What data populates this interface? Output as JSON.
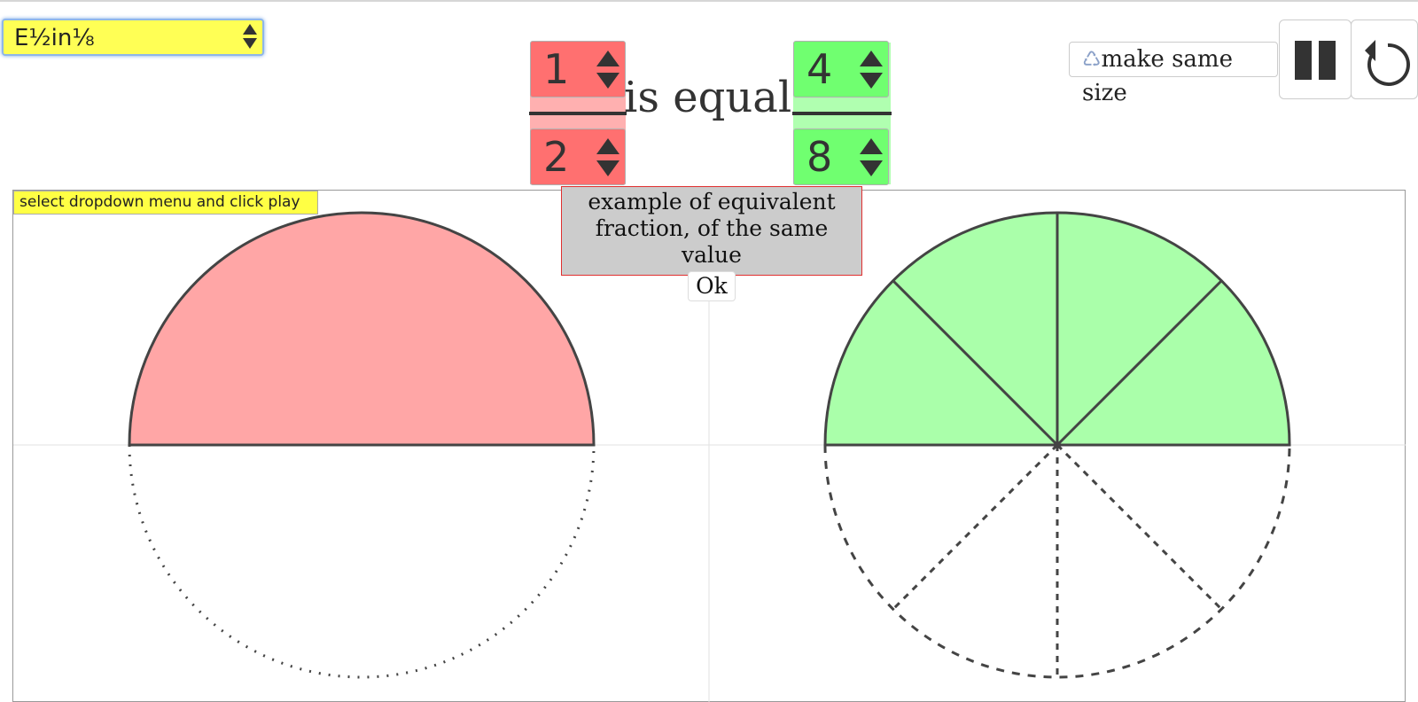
{
  "dropdown": {
    "selected": "E½in⅛"
  },
  "fraction_left": {
    "numerator": "1",
    "denominator": "2",
    "color": "#ff7070"
  },
  "equality_text": "is equal",
  "fraction_right": {
    "numerator": "4",
    "denominator": "8",
    "color": "#70ff70"
  },
  "toolbar": {
    "make_same_size_label": "make same size",
    "make_same_size_icon": "recycle-icon",
    "pause_icon": "pause-icon",
    "reset_icon": "reset-icon"
  },
  "hint": "select dropdown menu and click play",
  "dialog": {
    "line1": "example of equivalent",
    "line2": "fraction, of the same value",
    "ok_label": "Ok"
  },
  "colors": {
    "left_fill": "#ffa6a6",
    "right_fill": "#aaffaa",
    "hint_bg": "#ffff44",
    "dialog_bg": "#cccccc"
  },
  "figures": {
    "left_filled_slices": 1,
    "left_total_slices": 2,
    "right_filled_slices": 4,
    "right_total_slices": 8
  }
}
